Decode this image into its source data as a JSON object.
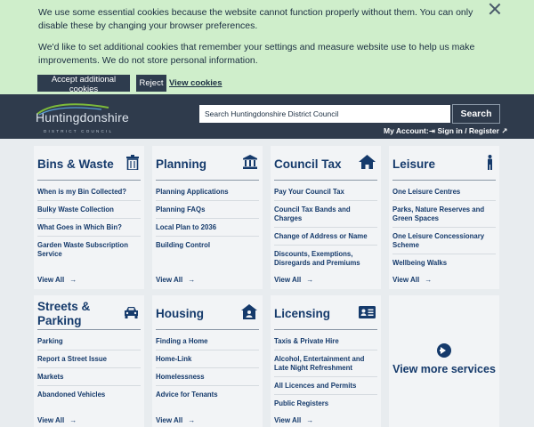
{
  "cookie": {
    "text1": "We use some essential cookies because the website cannot function properly without them. You can only disable these by changing your browser preferences.",
    "text2": "We'd like to set additional cookies that remember your settings and measure website use to help us make improvements. We do not store personal information.",
    "accept_label": "Accept additional cookies",
    "reject_label": "Reject",
    "view_label": "View cookies"
  },
  "header": {
    "logo_text": "Huntingdonshire",
    "logo_sub": "DISTRICT COUNCIL",
    "search_placeholder": "Search Huntingdonshire District Council",
    "search_label": "Search",
    "account_label": "My Account:",
    "signin_label": "Sign in / Register"
  },
  "cards": [
    {
      "title": "Bins & Waste",
      "icon": "trash-icon",
      "items": [
        "When is my Bin Collected?",
        "Bulky Waste Collection",
        "What Goes in Which Bin?",
        "Garden Waste Subscription Service"
      ],
      "view_all": "View All"
    },
    {
      "title": "Planning",
      "icon": "building-icon",
      "items": [
        "Planning Applications",
        "Planning FAQs",
        "Local Plan to 2036",
        "Building Control"
      ],
      "view_all": "View All"
    },
    {
      "title": "Council Tax",
      "icon": "home-icon",
      "items": [
        "Pay Your Council Tax",
        "Council Tax Bands and Charges",
        "Change of Address or Name",
        "Discounts, Exemptions, Disregards and Premiums"
      ],
      "view_all": "View All"
    },
    {
      "title": "Leisure",
      "icon": "person-icon",
      "items": [
        "One Leisure Centres",
        "Parks, Nature Reserves and Green Spaces",
        "One Leisure Concessionary Scheme",
        "Wellbeing Walks"
      ],
      "view_all": "View All"
    },
    {
      "title": "Streets & Parking",
      "icon": "car-icon",
      "items": [
        "Parking",
        "Report a Street Issue",
        "Markets",
        "Abandoned Vehicles"
      ],
      "view_all": "View All"
    },
    {
      "title": "Housing",
      "icon": "house-user-icon",
      "items": [
        "Finding a Home",
        "Home-Link",
        "Homelessness",
        "Advice for Tenants"
      ],
      "view_all": "View All"
    },
    {
      "title": "Licensing",
      "icon": "id-card-icon",
      "items": [
        "Taxis & Private Hire",
        "Alcohol, Entertainment and Late Night Refreshment",
        "All Licences and Permits",
        "Public Registers"
      ],
      "view_all": "View All"
    }
  ],
  "more": {
    "label": "View more services"
  }
}
